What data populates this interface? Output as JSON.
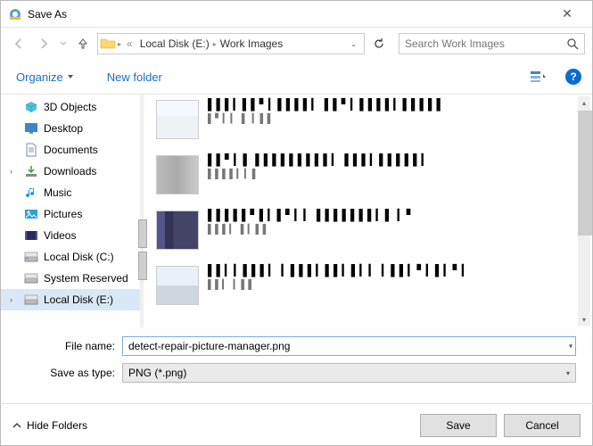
{
  "window": {
    "title": "Save As",
    "close": "✕"
  },
  "nav": {
    "breadcrumb_prefix": "«",
    "bc1": "Local Disk (E:)",
    "bc2": "Work Images",
    "refresh": "↻"
  },
  "search": {
    "placeholder": "Search Work Images"
  },
  "toolbar": {
    "organize": "Organize",
    "newfolder": "New folder"
  },
  "sidebar": {
    "items": [
      {
        "label": "3D Objects"
      },
      {
        "label": "Desktop"
      },
      {
        "label": "Documents"
      },
      {
        "label": "Downloads"
      },
      {
        "label": "Music"
      },
      {
        "label": "Pictures"
      },
      {
        "label": "Videos"
      },
      {
        "label": "Local Disk (C:)"
      },
      {
        "label": "System Reserved"
      },
      {
        "label": "Local Disk (E:)"
      }
    ]
  },
  "fields": {
    "name_label": "File name:",
    "name_value": "detect-repair-picture-manager.png",
    "type_label": "Save as type:",
    "type_value": "PNG (*.png)"
  },
  "footer": {
    "hide": "Hide Folders",
    "save": "Save",
    "cancel": "Cancel"
  }
}
